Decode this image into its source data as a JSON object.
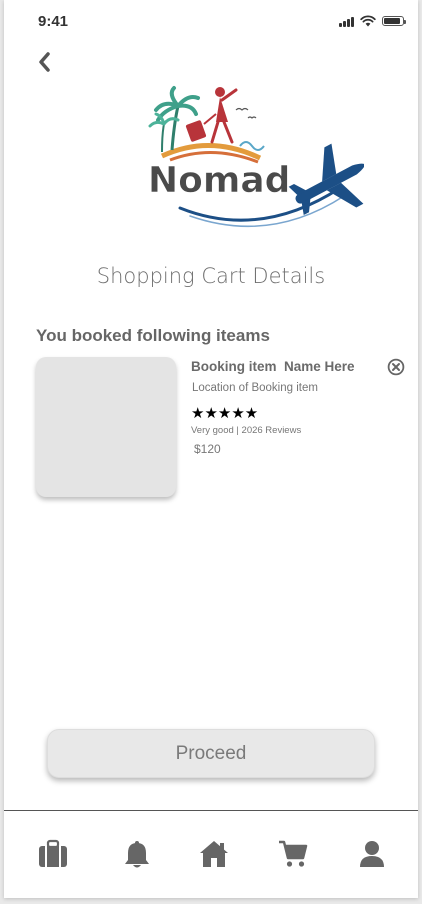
{
  "status_bar": {
    "time": "9:41",
    "icons": [
      "cellular-signal-icon",
      "wifi-icon",
      "battery-icon"
    ]
  },
  "header": {
    "back_icon": "chevron-left-icon",
    "logo_text": "Nomad"
  },
  "page": {
    "title": "Shopping Cart Details",
    "section_heading": "You booked following iteams"
  },
  "cart_items": [
    {
      "name": "Booking item  Name Here",
      "location": "Location of Booking item",
      "rating": 5,
      "rating_max": 5,
      "stars": "★★★★★",
      "reviews": "Very good | 2026 Reviews",
      "price": "$120",
      "remove_icon": "close-circle-icon"
    }
  ],
  "actions": {
    "proceed_label": "Proceed"
  },
  "bottom_nav": {
    "items": [
      "briefcase-icon",
      "bell-icon",
      "home-icon",
      "cart-icon",
      "user-icon"
    ]
  },
  "colors": {
    "logo_text": "#4a4a4a",
    "plane": "#1c4f86",
    "accent_red": "#b8343a",
    "palm": "#3fa08a",
    "icon_gray": "#666666"
  }
}
